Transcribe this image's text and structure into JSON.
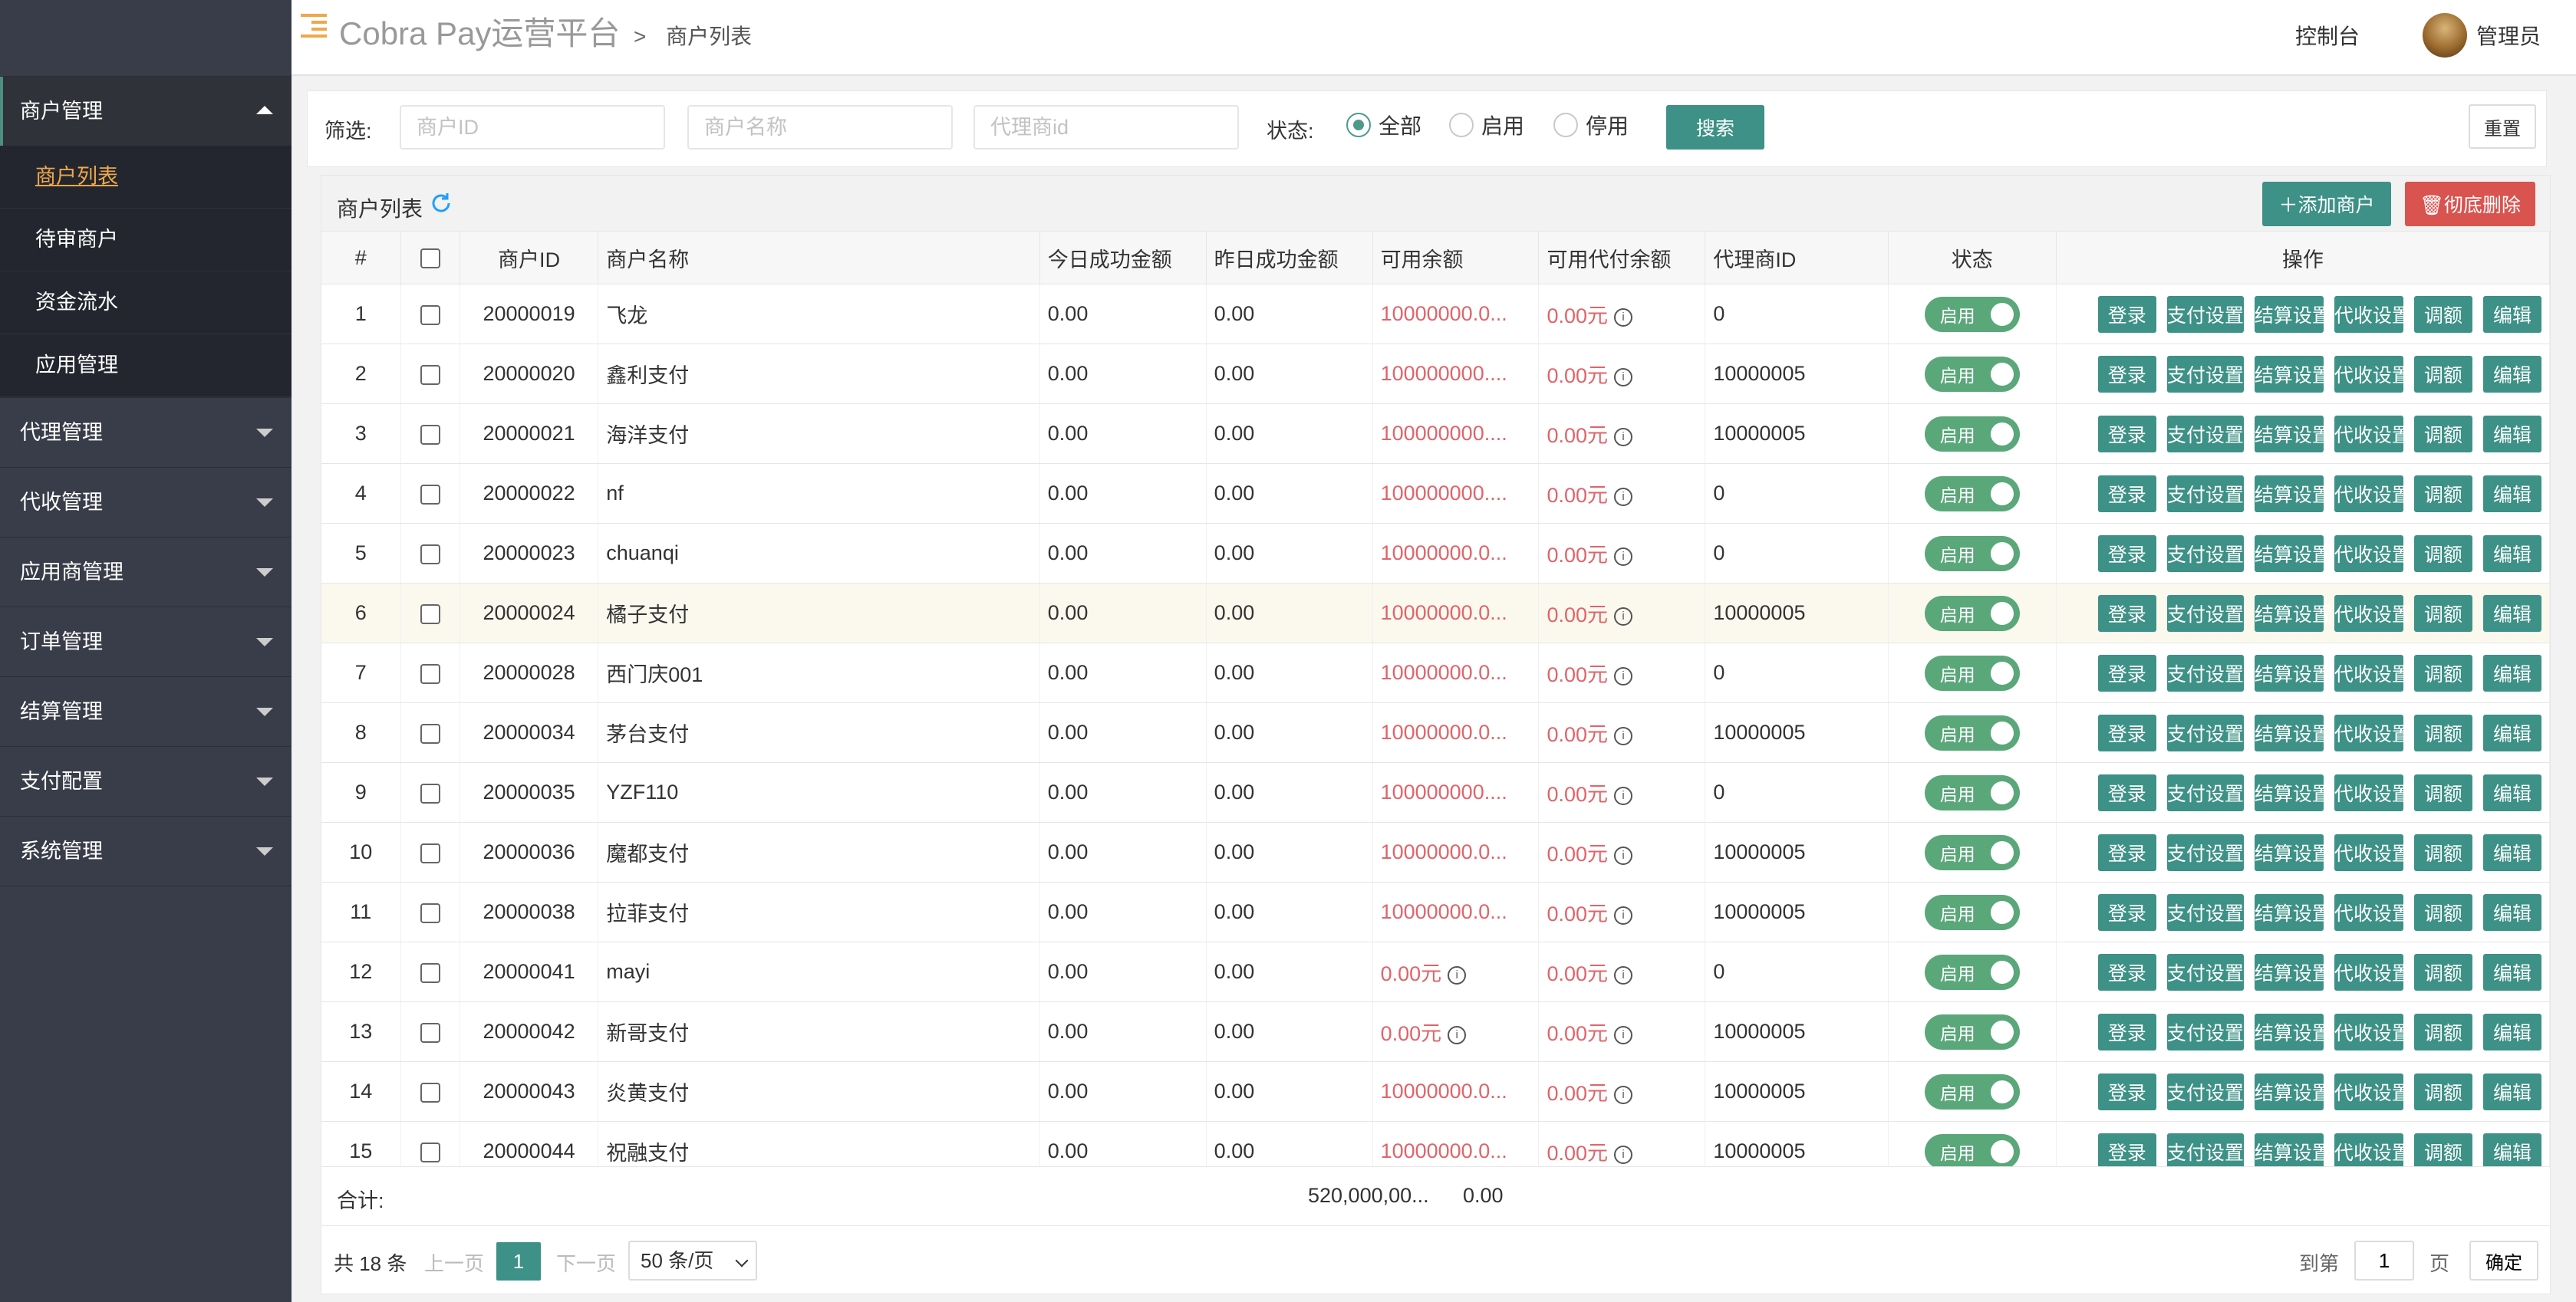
{
  "header": {
    "brand": "Cobra Pay运营平台",
    "breadcrumb_sep": ">",
    "breadcrumb": "商户列表",
    "console": "控制台",
    "admin": "管理员"
  },
  "sidebar": {
    "groups": [
      {
        "label": "商户管理",
        "open": true,
        "items": [
          "商户列表",
          "待审商户",
          "资金流水",
          "应用管理"
        ]
      },
      {
        "label": "代理管理"
      },
      {
        "label": "代收管理"
      },
      {
        "label": "应用商管理"
      },
      {
        "label": "订单管理"
      },
      {
        "label": "结算管理"
      },
      {
        "label": "支付配置"
      },
      {
        "label": "系统管理"
      }
    ]
  },
  "filter": {
    "label": "筛选:",
    "merchant_id_placeholder": "商户ID",
    "merchant_name_placeholder": "商户名称",
    "agent_id_placeholder": "代理商id",
    "status_label": "状态:",
    "options": [
      "全部",
      "启用",
      "停用"
    ],
    "selected": "全部",
    "search": "搜索",
    "reset": "重置"
  },
  "list": {
    "title": "商户列表",
    "add": "添加商户",
    "delete": "彻底删除",
    "columns": [
      "#",
      "商户ID",
      "商户名称",
      "今日成功金额",
      "昨日成功金额",
      "可用余额",
      "可用代付余额",
      "代理商ID",
      "状态",
      "操作"
    ],
    "ops": [
      "登录",
      "支付设置",
      "结算设置",
      "代收设置",
      "调额",
      "编辑"
    ],
    "status_on": "启用",
    "rows": [
      {
        "n": "1",
        "id": "20000019",
        "name": "飞龙",
        "today": "0.00",
        "yesterday": "0.00",
        "balance": "10000000.0...",
        "payout": "0.00元",
        "agent": "0"
      },
      {
        "n": "2",
        "id": "20000020",
        "name": "鑫利支付",
        "today": "0.00",
        "yesterday": "0.00",
        "balance": "100000000....",
        "payout": "0.00元",
        "agent": "10000005"
      },
      {
        "n": "3",
        "id": "20000021",
        "name": "海洋支付",
        "today": "0.00",
        "yesterday": "0.00",
        "balance": "100000000....",
        "payout": "0.00元",
        "agent": "10000005"
      },
      {
        "n": "4",
        "id": "20000022",
        "name": "nf",
        "today": "0.00",
        "yesterday": "0.00",
        "balance": "100000000....",
        "payout": "0.00元",
        "agent": "0"
      },
      {
        "n": "5",
        "id": "20000023",
        "name": "chuanqi",
        "today": "0.00",
        "yesterday": "0.00",
        "balance": "10000000.0...",
        "payout": "0.00元",
        "agent": "0"
      },
      {
        "n": "6",
        "id": "20000024",
        "name": "橘子支付",
        "today": "0.00",
        "yesterday": "0.00",
        "balance": "10000000.0...",
        "payout": "0.00元",
        "agent": "10000005"
      },
      {
        "n": "7",
        "id": "20000028",
        "name": "西门庆001",
        "today": "0.00",
        "yesterday": "0.00",
        "balance": "10000000.0...",
        "payout": "0.00元",
        "agent": "0"
      },
      {
        "n": "8",
        "id": "20000034",
        "name": "茅台支付",
        "today": "0.00",
        "yesterday": "0.00",
        "balance": "10000000.0...",
        "payout": "0.00元",
        "agent": "10000005"
      },
      {
        "n": "9",
        "id": "20000035",
        "name": "YZF110",
        "today": "0.00",
        "yesterday": "0.00",
        "balance": "100000000....",
        "payout": "0.00元",
        "agent": "0"
      },
      {
        "n": "10",
        "id": "20000036",
        "name": "魔都支付",
        "today": "0.00",
        "yesterday": "0.00",
        "balance": "10000000.0...",
        "payout": "0.00元",
        "agent": "10000005"
      },
      {
        "n": "11",
        "id": "20000038",
        "name": "拉菲支付",
        "today": "0.00",
        "yesterday": "0.00",
        "balance": "10000000.0...",
        "payout": "0.00元",
        "agent": "10000005"
      },
      {
        "n": "12",
        "id": "20000041",
        "name": "mayi",
        "today": "0.00",
        "yesterday": "0.00",
        "balance": "0.00元",
        "balance_info": true,
        "payout": "0.00元",
        "agent": "0"
      },
      {
        "n": "13",
        "id": "20000042",
        "name": "新哥支付",
        "today": "0.00",
        "yesterday": "0.00",
        "balance": "0.00元",
        "balance_info": true,
        "payout": "0.00元",
        "agent": "10000005"
      },
      {
        "n": "14",
        "id": "20000043",
        "name": "炎黄支付",
        "today": "0.00",
        "yesterday": "0.00",
        "balance": "10000000.0...",
        "payout": "0.00元",
        "agent": "10000005"
      },
      {
        "n": "15",
        "id": "20000044",
        "name": "祝融支付",
        "today": "0.00",
        "yesterday": "0.00",
        "balance": "10000000.0...",
        "payout": "0.00元",
        "agent": "10000005"
      }
    ],
    "highlight_row": 6,
    "sum_label": "合计:",
    "sum_balance": "520,000,00...",
    "sum_payout": "0.00"
  },
  "pager": {
    "total": "共 18 条",
    "prev": "上一页",
    "current": "1",
    "next": "下一页",
    "size": "50 条/页",
    "goto_label": "到第",
    "goto_value": "1",
    "page_unit": "页",
    "confirm": "确定"
  },
  "colors": {
    "primary": "#3d9186",
    "danger": "#d9534f",
    "sidebar": "#393d49",
    "amount": "#e0646a",
    "switch": "#5aa77a"
  }
}
